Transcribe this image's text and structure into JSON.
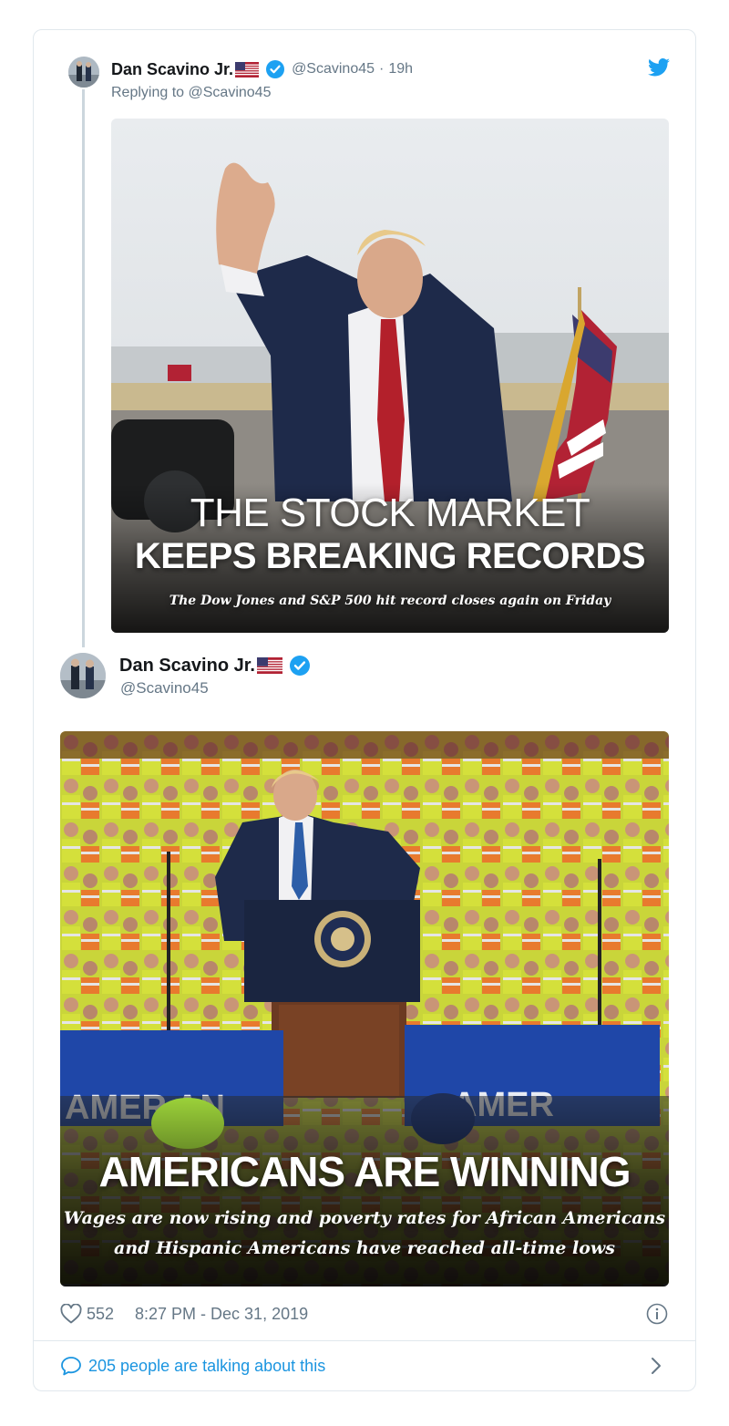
{
  "tweet1": {
    "author_name": "Dan Scavino Jr.",
    "handle": "@Scavino45",
    "separator": "·",
    "age": "19h",
    "reply_prefix": "Replying to",
    "reply_handle": "@Scavino45",
    "image": {
      "headline_line1": "THE STOCK MARKET",
      "headline_line2": "KEEPS BREAKING RECORDS",
      "subline": "The Dow Jones and S&P 500 hit record closes again on Friday"
    }
  },
  "tweet2": {
    "author_name": "Dan Scavino Jr.",
    "handle": "@Scavino45",
    "image": {
      "banner_left": "AMER  AN",
      "banner_right": "AMER",
      "headline": "AMERICANS ARE WINNING",
      "subline_line1": "Wages are now rising and poverty rates for African Americans",
      "subline_line2": "and Hispanic Americans have reached all-time lows"
    }
  },
  "footer": {
    "likes": "552",
    "timestamp": "8:27 PM - Dec 31, 2019",
    "conversation": "205 people are talking about this"
  },
  "colors": {
    "twitter_blue": "#1da1f2",
    "link_blue": "#1b95e0",
    "muted": "#657786",
    "border": "#e1e8ed"
  },
  "icons": [
    "twitter-bird-icon",
    "verified-badge-icon",
    "us-flag-icon",
    "heart-icon",
    "info-icon",
    "speech-bubble-icon",
    "chevron-right-icon"
  ]
}
